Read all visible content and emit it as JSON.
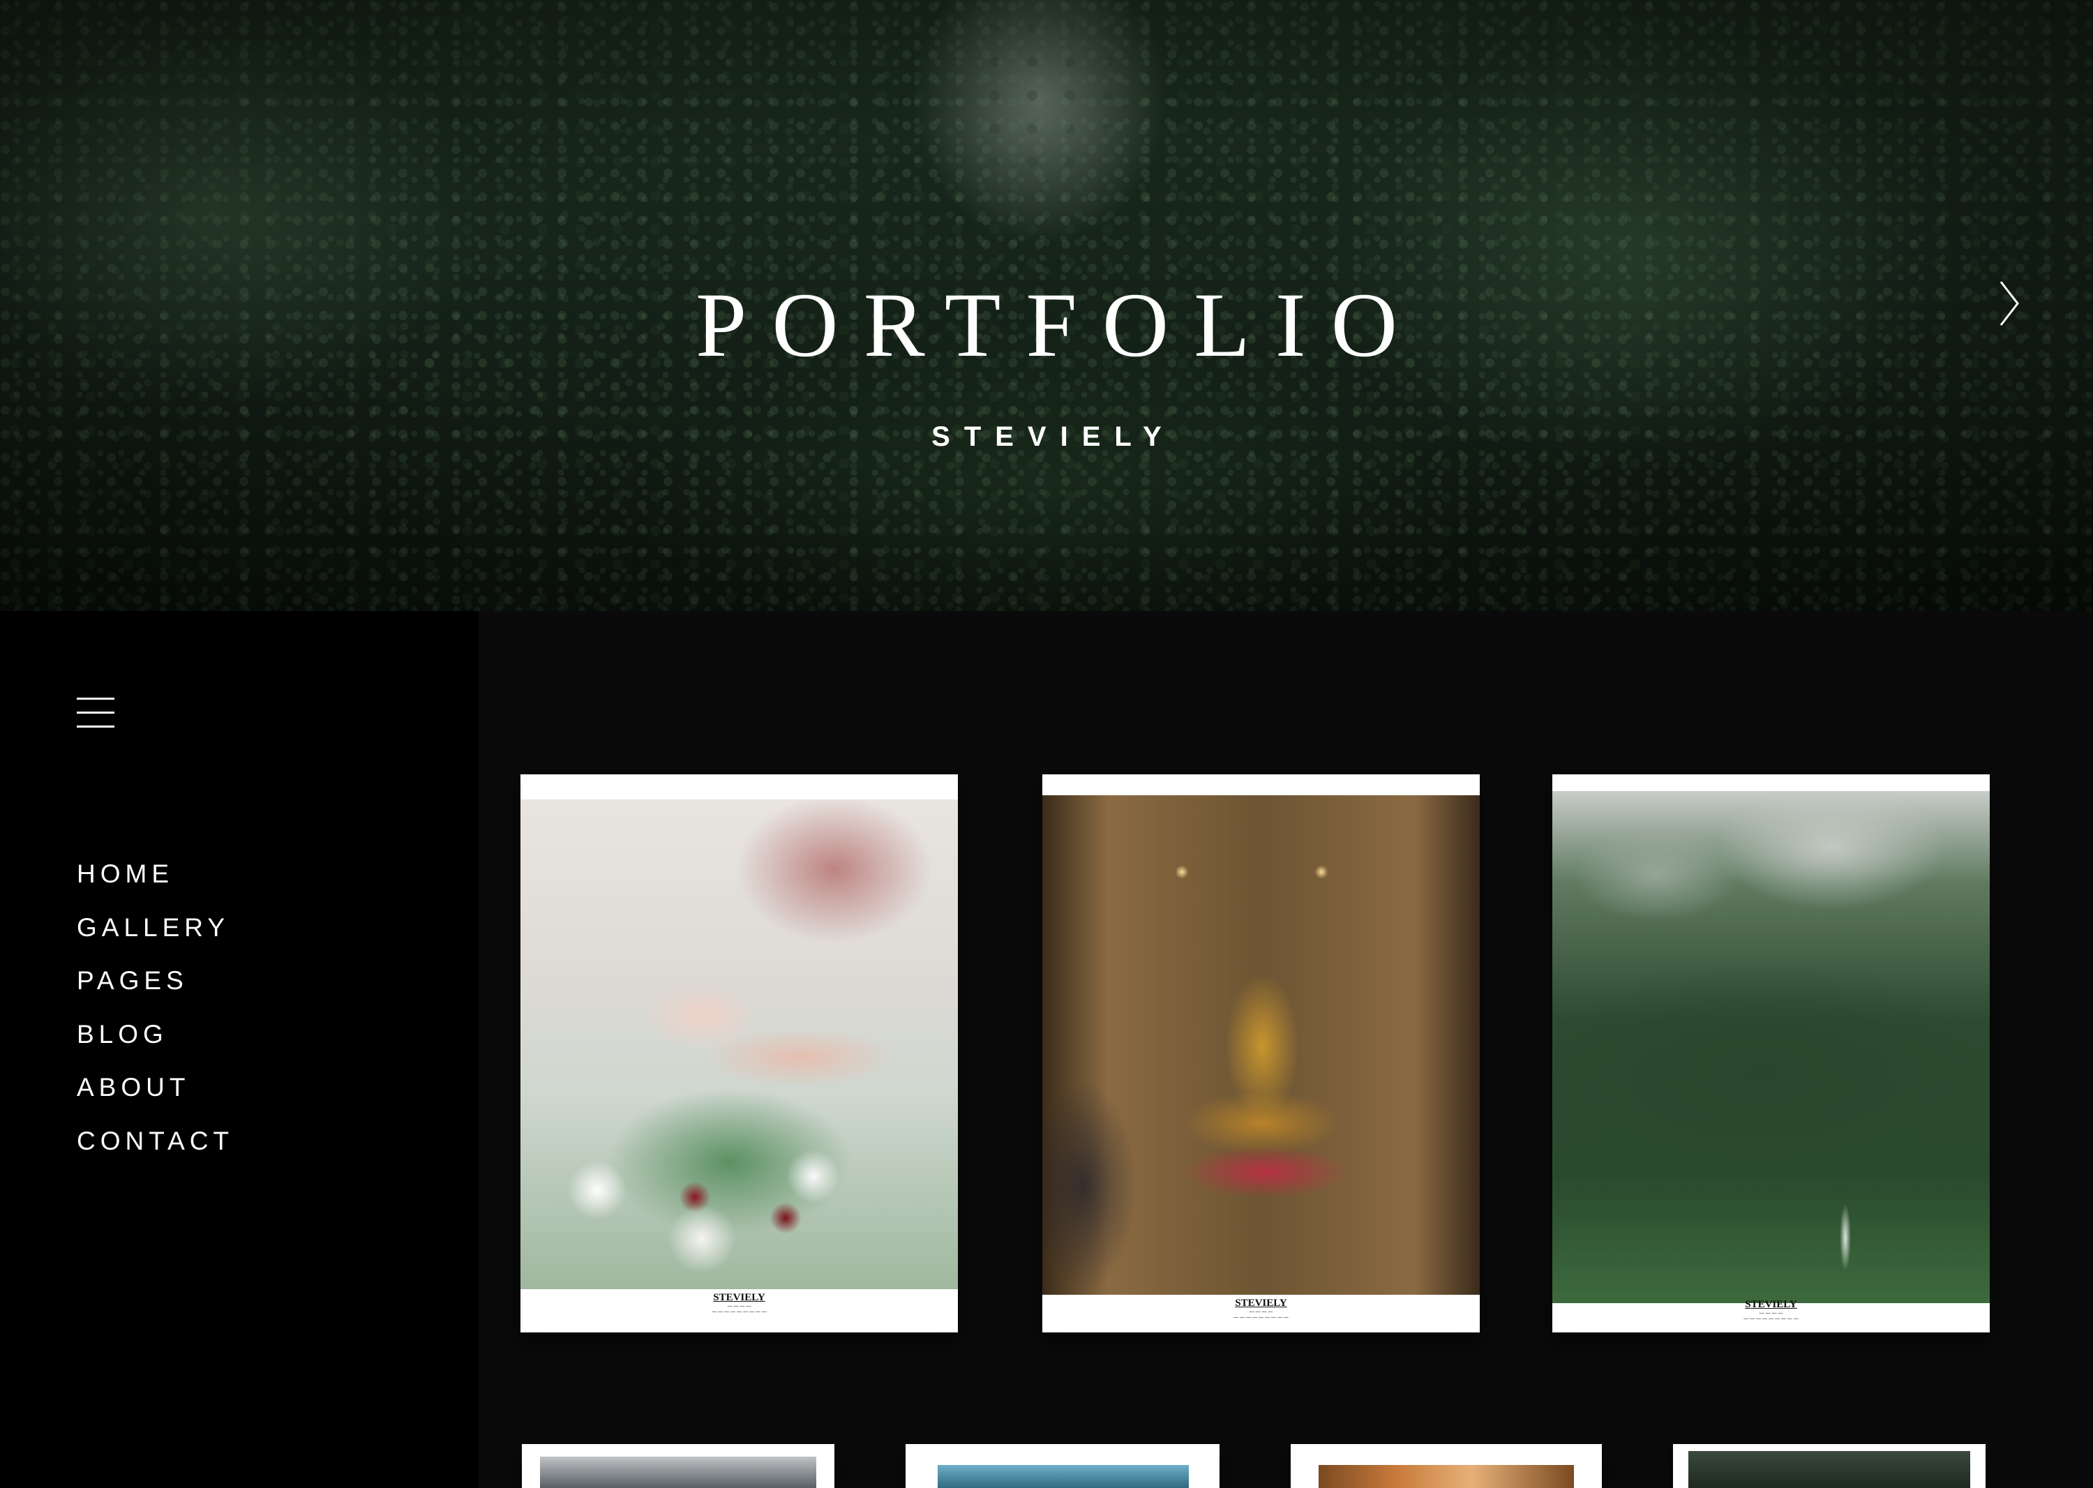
{
  "hero": {
    "title": "PORTFOLIO",
    "subtitle": "STEVIELY",
    "next_icon": "chevron-right-icon"
  },
  "sidebar": {
    "menu_icon": "hamburger-menu-icon",
    "nav": [
      {
        "label": "HOME"
      },
      {
        "label": "GALLERY"
      },
      {
        "label": "PAGES"
      },
      {
        "label": "BLOG"
      },
      {
        "label": "ABOUT"
      },
      {
        "label": "CONTACT"
      }
    ]
  },
  "gallery": {
    "cards": [
      {
        "caption": "STEVIELY"
      },
      {
        "caption": "STEVIELY"
      },
      {
        "caption": "STEVIELY"
      }
    ]
  },
  "colors": {
    "sidebar_bg": "#000000",
    "main_bg": "#0a0a0a",
    "text": "#ffffff"
  }
}
